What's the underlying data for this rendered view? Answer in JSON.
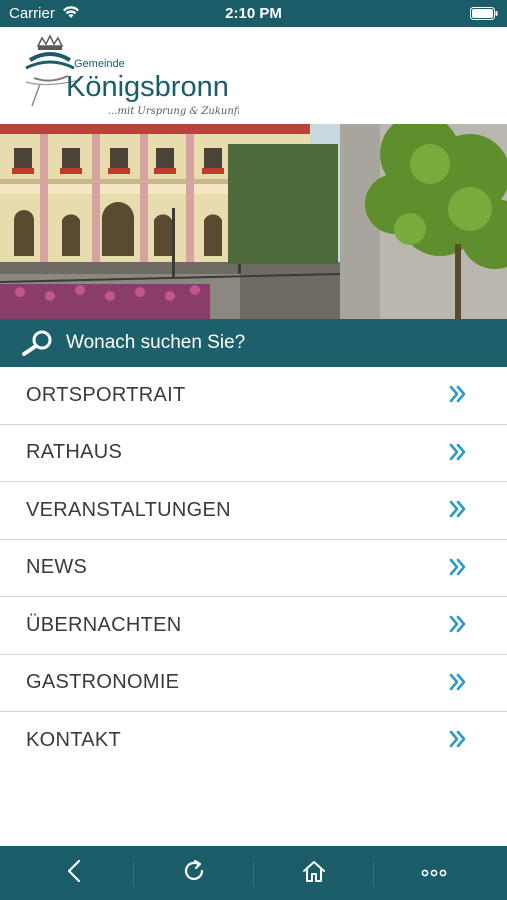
{
  "status_bar": {
    "carrier": "Carrier",
    "time": "2:10 PM"
  },
  "header": {
    "logo_line1": "Gemeinde",
    "logo_line2": "Königsbronn",
    "logo_tagline": "...mit Ursprung & Zukunft"
  },
  "search": {
    "placeholder": "Wonach suchen Sie?"
  },
  "menu": {
    "items": [
      {
        "label": "ORTSPORTRAIT"
      },
      {
        "label": "RATHAUS"
      },
      {
        "label": "VERANSTALTUNGEN"
      },
      {
        "label": "NEWS"
      },
      {
        "label": "ÜBERNACHTEN"
      },
      {
        "label": "GASTRONOMIE"
      },
      {
        "label": "KONTAKT"
      }
    ],
    "chevron_color": "#2a9bc6"
  },
  "colors": {
    "brand": "#1a5d68",
    "accent": "#2a9bc6"
  },
  "toolbar": {
    "back_icon": "chevron-left-icon",
    "reload_icon": "reload-icon",
    "home_icon": "home-icon",
    "more_icon": "more-dots-icon"
  }
}
